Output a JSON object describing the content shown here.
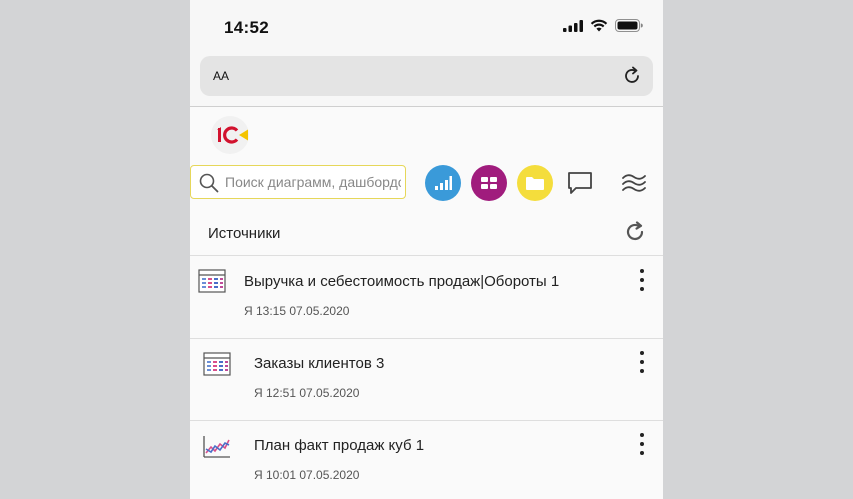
{
  "status_bar": {
    "time": "14:52"
  },
  "browser": {
    "text_size_label": "AA"
  },
  "toolbar": {
    "search_placeholder": "Поиск диаграмм, дашбордов",
    "colors": {
      "chart_button": "#3a9ad9",
      "dashboard_button": "#a01c7d",
      "folder_button": "#f4dd3c"
    }
  },
  "sources": {
    "title": "Источники",
    "items": [
      {
        "title": "Выручка и себестоимость продаж|Обороты 1",
        "meta": "Я 13:15 07.05.2020",
        "icon": "table-icon"
      },
      {
        "title": "Заказы клиентов 3",
        "meta": "Я 12:51 07.05.2020",
        "icon": "table-icon"
      },
      {
        "title": "План факт продаж куб 1",
        "meta": "Я 10:01 07.05.2020",
        "icon": "line-chart-icon"
      }
    ]
  }
}
